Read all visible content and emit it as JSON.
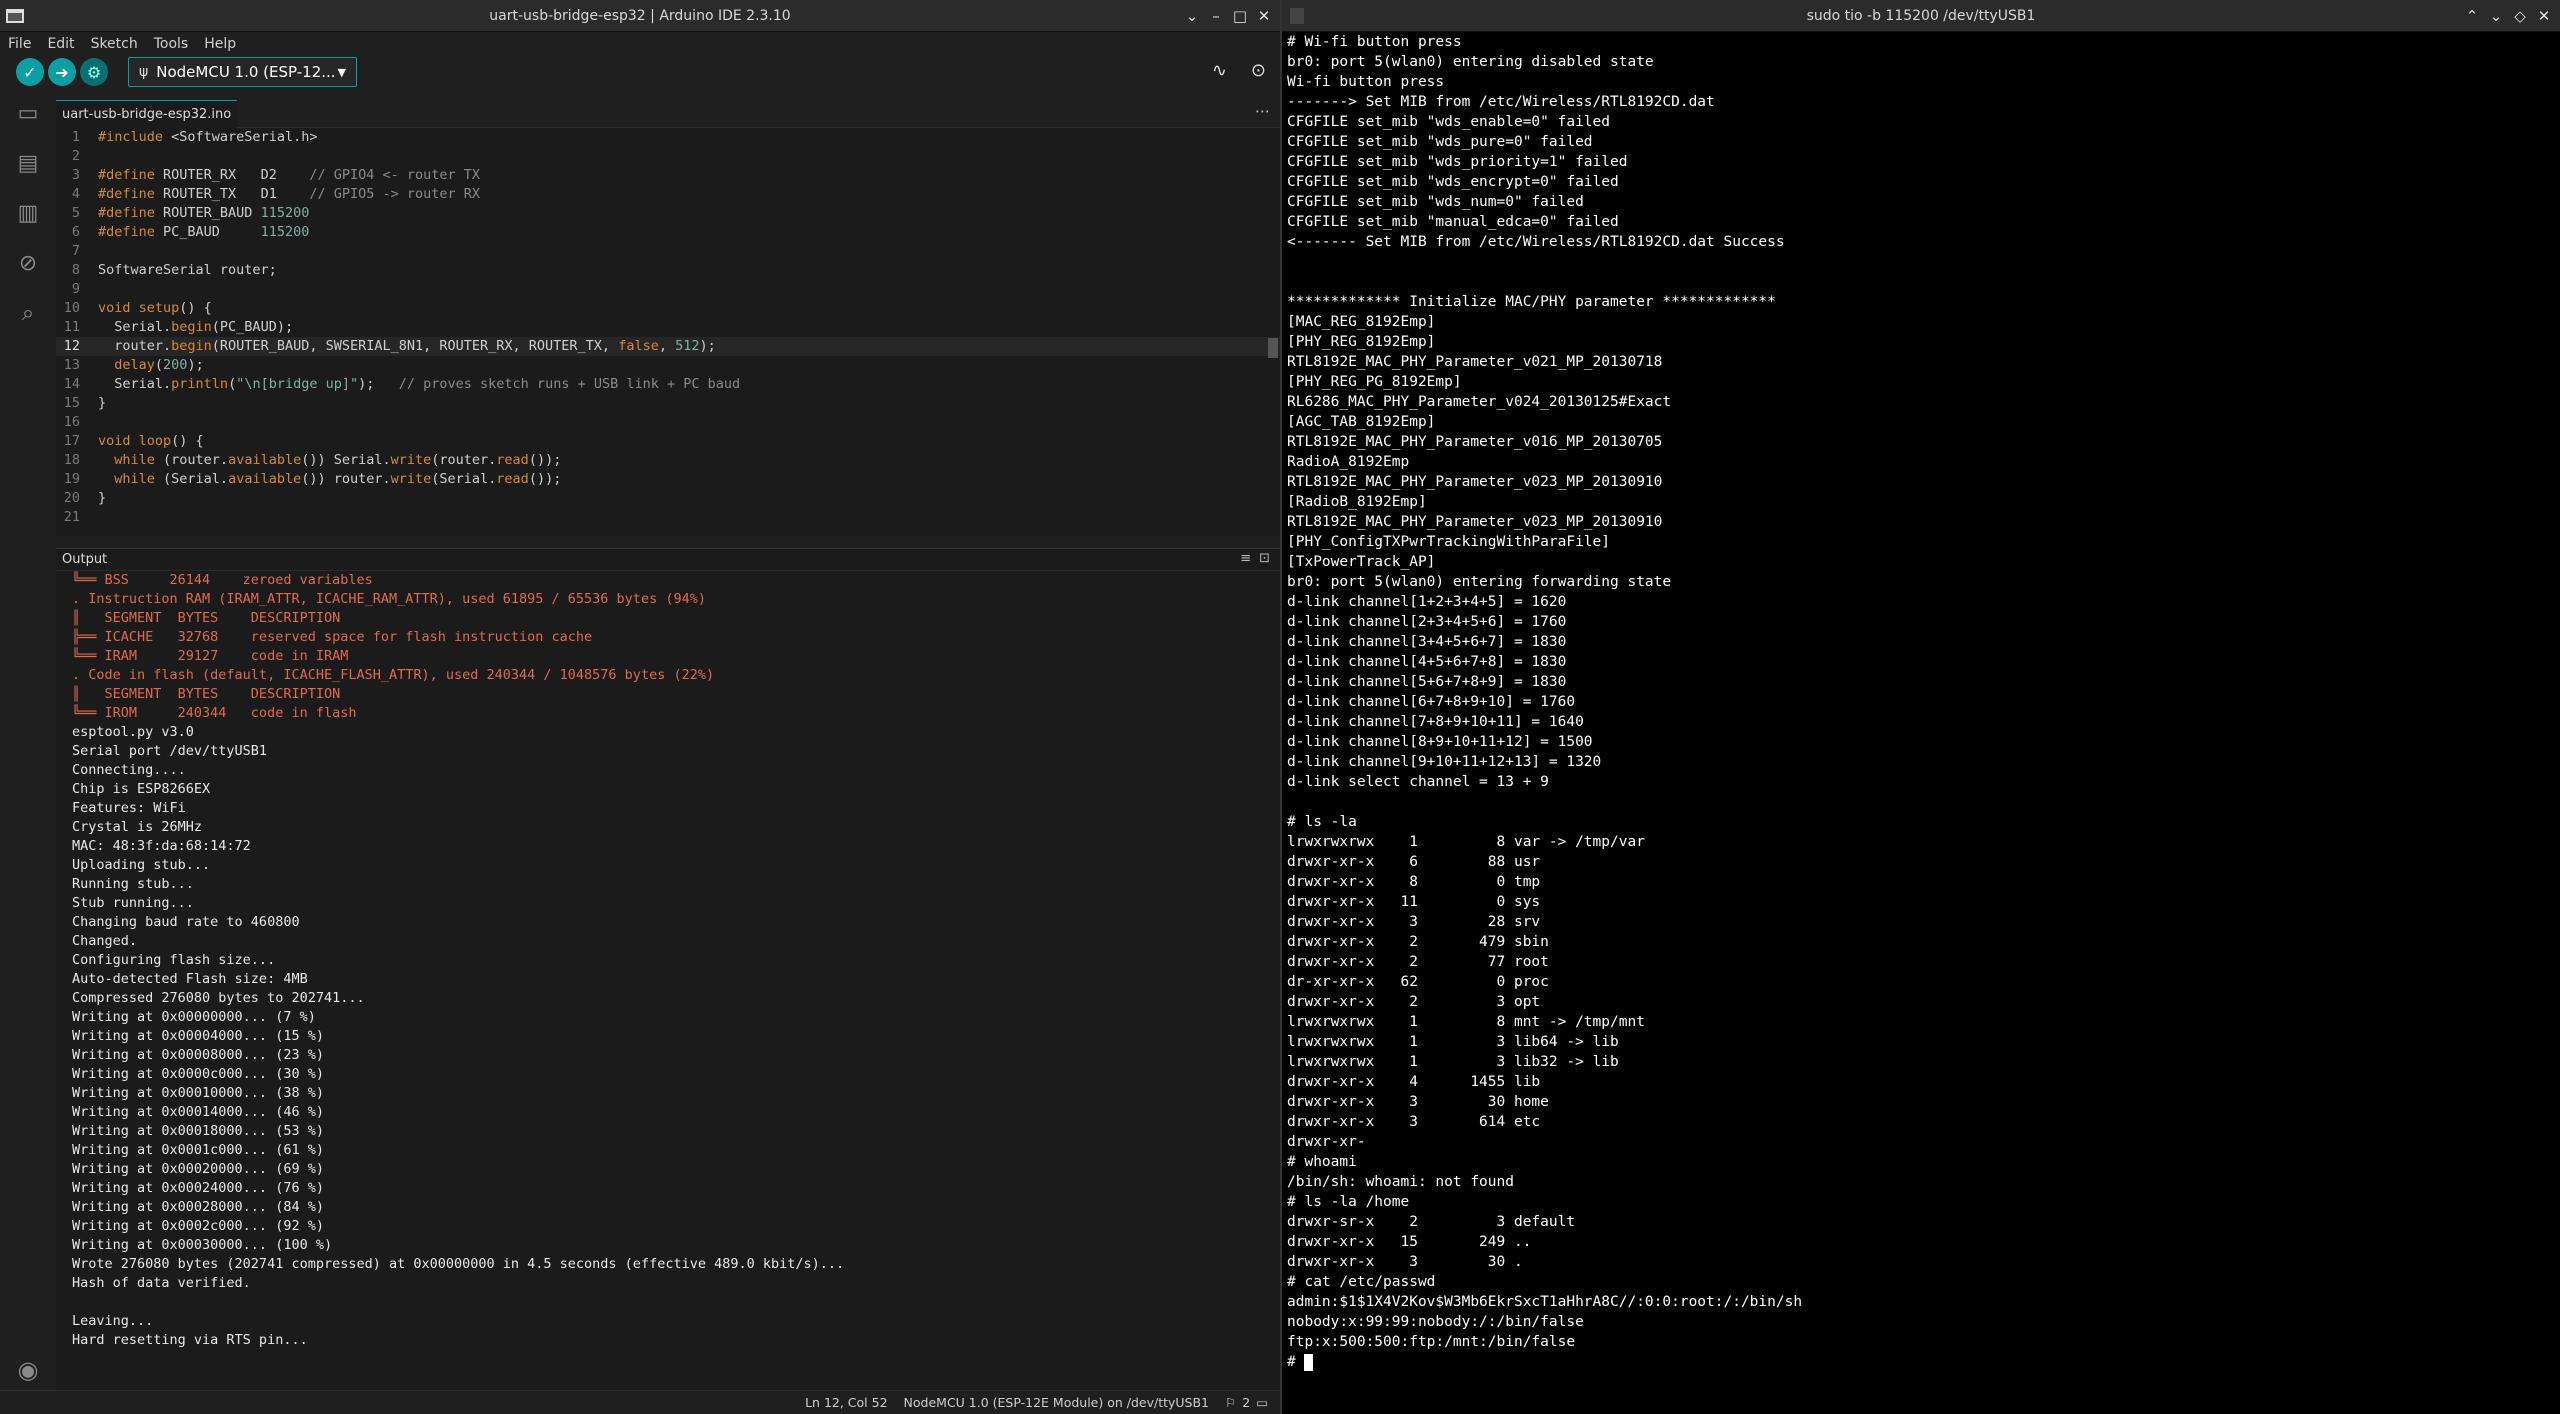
{
  "ide": {
    "window_title": "uart-usb-bridge-esp32 | Arduino IDE 2.3.10",
    "menu": [
      "File",
      "Edit",
      "Sketch",
      "Tools",
      "Help"
    ],
    "board_selector": "NodeMCU 1.0 (ESP-12...",
    "tab_name": "uart-usb-bridge-esp32.ino",
    "code_lines": [
      "#include <SoftwareSerial.h>",
      "",
      "#define ROUTER_RX   D2    // GPIO4 <- router TX",
      "#define ROUTER_TX   D1    // GPIO5 -> router RX",
      "#define ROUTER_BAUD 115200",
      "#define PC_BAUD     115200",
      "",
      "SoftwareSerial router;",
      "",
      "void setup() {",
      "  Serial.begin(PC_BAUD);",
      "  router.begin(ROUTER_BAUD, SWSERIAL_8N1, ROUTER_RX, ROUTER_TX, false, 512);",
      "  delay(200);",
      "  Serial.println(\"\\n[bridge up]\");   // proves sketch runs + USB link + PC baud",
      "}",
      "",
      "void loop() {",
      "  while (router.available()) Serial.write(router.read());",
      "  while (Serial.available()) router.write(Serial.read());",
      "}",
      ""
    ],
    "current_line": 12,
    "output_title": "Output",
    "output_lines": [
      {
        "t": "╚══ BSS     26144    zeroed variables",
        "w": true
      },
      {
        "t": ". Instruction RAM (IRAM_ATTR, ICACHE_RAM_ATTR), used 61895 / 65536 bytes (94%)",
        "w": true
      },
      {
        "t": "║   SEGMENT  BYTES    DESCRIPTION",
        "w": true
      },
      {
        "t": "╠══ ICACHE   32768    reserved space for flash instruction cache",
        "w": true
      },
      {
        "t": "╚══ IRAM     29127    code in IRAM",
        "w": true
      },
      {
        "t": ". Code in flash (default, ICACHE_FLASH_ATTR), used 240344 / 1048576 bytes (22%)",
        "w": true
      },
      {
        "t": "║   SEGMENT  BYTES    DESCRIPTION",
        "w": true
      },
      {
        "t": "╚══ IROM     240344   code in flash",
        "w": true
      },
      {
        "t": "esptool.py v3.0",
        "w": false
      },
      {
        "t": "Serial port /dev/ttyUSB1",
        "w": false
      },
      {
        "t": "Connecting....",
        "w": false
      },
      {
        "t": "Chip is ESP8266EX",
        "w": false
      },
      {
        "t": "Features: WiFi",
        "w": false
      },
      {
        "t": "Crystal is 26MHz",
        "w": false
      },
      {
        "t": "MAC: 48:3f:da:68:14:72",
        "w": false
      },
      {
        "t": "Uploading stub...",
        "w": false
      },
      {
        "t": "Running stub...",
        "w": false
      },
      {
        "t": "Stub running...",
        "w": false
      },
      {
        "t": "Changing baud rate to 460800",
        "w": false
      },
      {
        "t": "Changed.",
        "w": false
      },
      {
        "t": "Configuring flash size...",
        "w": false
      },
      {
        "t": "Auto-detected Flash size: 4MB",
        "w": false
      },
      {
        "t": "Compressed 276080 bytes to 202741...",
        "w": false
      },
      {
        "t": "Writing at 0x00000000... (7 %)",
        "w": false
      },
      {
        "t": "Writing at 0x00004000... (15 %)",
        "w": false
      },
      {
        "t": "Writing at 0x00008000... (23 %)",
        "w": false
      },
      {
        "t": "Writing at 0x0000c000... (30 %)",
        "w": false
      },
      {
        "t": "Writing at 0x00010000... (38 %)",
        "w": false
      },
      {
        "t": "Writing at 0x00014000... (46 %)",
        "w": false
      },
      {
        "t": "Writing at 0x00018000... (53 %)",
        "w": false
      },
      {
        "t": "Writing at 0x0001c000... (61 %)",
        "w": false
      },
      {
        "t": "Writing at 0x00020000... (69 %)",
        "w": false
      },
      {
        "t": "Writing at 0x00024000... (76 %)",
        "w": false
      },
      {
        "t": "Writing at 0x00028000... (84 %)",
        "w": false
      },
      {
        "t": "Writing at 0x0002c000... (92 %)",
        "w": false
      },
      {
        "t": "Writing at 0x00030000... (100 %)",
        "w": false
      },
      {
        "t": "Wrote 276080 bytes (202741 compressed) at 0x00000000 in 4.5 seconds (effective 489.0 kbit/s)...",
        "w": false
      },
      {
        "t": "Hash of data verified.",
        "w": false
      },
      {
        "t": "",
        "w": false
      },
      {
        "t": "Leaving...",
        "w": false
      },
      {
        "t": "Hard resetting via RTS pin...",
        "w": false
      }
    ],
    "status": {
      "cursor_pos": "Ln 12, Col 52",
      "board_port": "NodeMCU 1.0 (ESP-12E Module) on /dev/ttyUSB1",
      "notifications": "2"
    }
  },
  "terminal": {
    "window_title": "sudo tio -b 115200 /dev/ttyUSB1",
    "lines": [
      "# Wi-fi button press",
      "br0: port 5(wlan0) entering disabled state",
      "Wi-fi button press",
      "-------> Set MIB from /etc/Wireless/RTL8192CD.dat",
      "CFGFILE set_mib \"wds_enable=0\" failed",
      "CFGFILE set_mib \"wds_pure=0\" failed",
      "CFGFILE set_mib \"wds_priority=1\" failed",
      "CFGFILE set_mib \"wds_encrypt=0\" failed",
      "CFGFILE set_mib \"wds_num=0\" failed",
      "CFGFILE set_mib \"manual_edca=0\" failed",
      "<------- Set MIB from /etc/Wireless/RTL8192CD.dat Success",
      "",
      "",
      "************* Initialize MAC/PHY parameter *************",
      "[MAC_REG_8192Emp]",
      "[PHY_REG_8192Emp]",
      "RTL8192E_MAC_PHY_Parameter_v021_MP_20130718",
      "[PHY_REG_PG_8192Emp]",
      "RL6286_MAC_PHY_Parameter_v024_20130125#Exact",
      "[AGC_TAB_8192Emp]",
      "RTL8192E_MAC_PHY_Parameter_v016_MP_20130705",
      "RadioA_8192Emp",
      "RTL8192E_MAC_PHY_Parameter_v023_MP_20130910",
      "[RadioB_8192Emp]",
      "RTL8192E_MAC_PHY_Parameter_v023_MP_20130910",
      "[PHY_ConfigTXPwrTrackingWithParaFile]",
      "[TxPowerTrack_AP]",
      "br0: port 5(wlan0) entering forwarding state",
      "d-link channel[1+2+3+4+5] = 1620",
      "d-link channel[2+3+4+5+6] = 1760",
      "d-link channel[3+4+5+6+7] = 1830",
      "d-link channel[4+5+6+7+8] = 1830",
      "d-link channel[5+6+7+8+9] = 1830",
      "d-link channel[6+7+8+9+10] = 1760",
      "d-link channel[7+8+9+10+11] = 1640",
      "d-link channel[8+9+10+11+12] = 1500",
      "d-link channel[9+10+11+12+13] = 1320",
      "d-link select channel = 13 + 9",
      "",
      "# ls -la",
      "lrwxrwxrwx    1         8 var -> /tmp/var",
      "drwxr-xr-x    6        88 usr",
      "drwxr-xr-x    8         0 tmp",
      "drwxr-xr-x   11         0 sys",
      "drwxr-xr-x    3        28 srv",
      "drwxr-xr-x    2       479 sbin",
      "drwxr-xr-x    2        77 root",
      "dr-xr-xr-x   62         0 proc",
      "drwxr-xr-x    2         3 opt",
      "lrwxrwxrwx    1         8 mnt -> /tmp/mnt",
      "lrwxrwxrwx    1         3 lib64 -> lib",
      "lrwxrwxrwx    1         3 lib32 -> lib",
      "drwxr-xr-x    4      1455 lib",
      "drwxr-xr-x    3        30 home",
      "drwxr-xr-x    3       614 etc",
      "drwxr-xr-",
      "# whoami",
      "/bin/sh: whoami: not found",
      "# ls -la /home",
      "drwxr-sr-x    2         3 default",
      "drwxr-xr-x   15       249 ..",
      "drwxr-xr-x    3        30 .",
      "# cat /etc/passwd",
      "admin:$1$1X4V2Kov$W3Mb6EkrSxcT1aHhrA8C//:0:0:root:/:/bin/sh",
      "nobody:x:99:99:nobody:/:/bin/false",
      "ftp:x:500:500:ftp:/mnt:/bin/false",
      "# "
    ]
  }
}
